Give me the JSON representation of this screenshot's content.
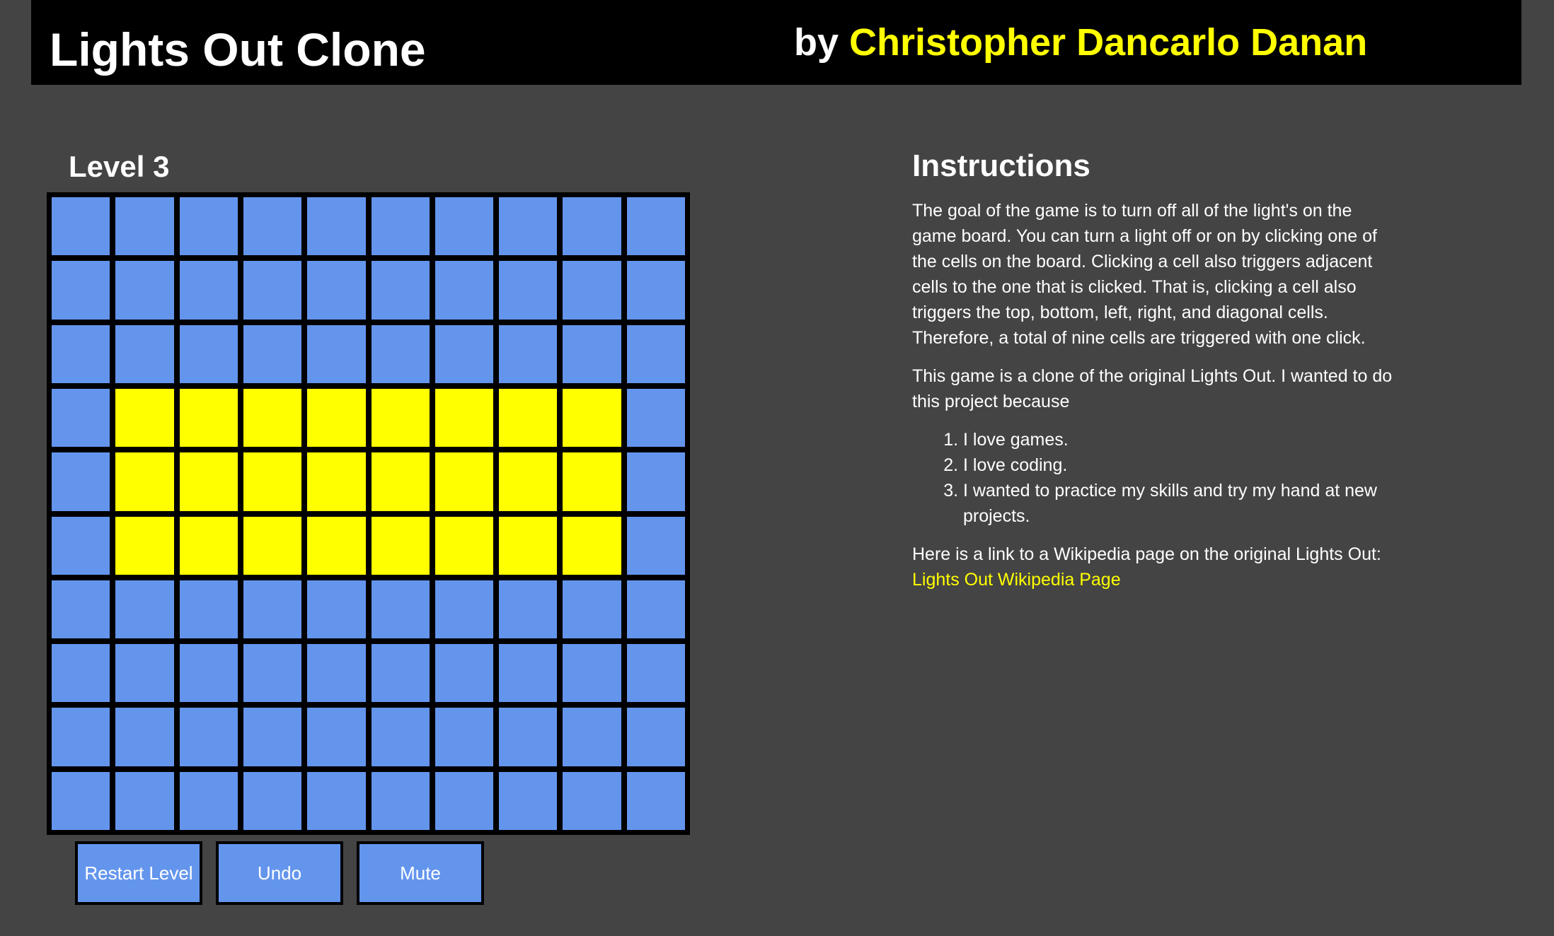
{
  "header": {
    "title": "Lights Out Clone",
    "by_label": "by",
    "author": "Christopher Dancarlo Danan"
  },
  "game": {
    "level_label": "Level 3",
    "board": {
      "rows": 10,
      "cols": 10,
      "cells": [
        [
          0,
          0,
          0,
          0,
          0,
          0,
          0,
          0,
          0,
          0
        ],
        [
          0,
          0,
          0,
          0,
          0,
          0,
          0,
          0,
          0,
          0
        ],
        [
          0,
          0,
          0,
          0,
          0,
          0,
          0,
          0,
          0,
          0
        ],
        [
          0,
          1,
          1,
          1,
          1,
          1,
          1,
          1,
          1,
          0
        ],
        [
          0,
          1,
          1,
          1,
          1,
          1,
          1,
          1,
          1,
          0
        ],
        [
          0,
          1,
          1,
          1,
          1,
          1,
          1,
          1,
          1,
          0
        ],
        [
          0,
          0,
          0,
          0,
          0,
          0,
          0,
          0,
          0,
          0
        ],
        [
          0,
          0,
          0,
          0,
          0,
          0,
          0,
          0,
          0,
          0
        ],
        [
          0,
          0,
          0,
          0,
          0,
          0,
          0,
          0,
          0,
          0
        ],
        [
          0,
          0,
          0,
          0,
          0,
          0,
          0,
          0,
          0,
          0
        ]
      ]
    },
    "buttons": {
      "restart": "Restart Level",
      "undo": "Undo",
      "mute": "Mute"
    }
  },
  "instructions": {
    "heading": "Instructions",
    "paragraph1": "The goal of the game is to turn off all of the light's on the game board. You can turn a light off or on by clicking one of the cells on the board. Clicking a cell also triggers adjacent cells to the one that is clicked. That is, clicking a cell also triggers the top, bottom, left, right, and diagonal cells. Therefore, a total of nine cells are triggered with one click.",
    "paragraph2": "This game is a clone of the original Lights Out. I wanted to do this project because",
    "reasons": [
      "I love games.",
      "I love coding.",
      "I wanted to practice my skills and try my hand at new projects."
    ],
    "link_intro": "Here is a link to a Wikipedia page on the original Lights Out: ",
    "link_text": "Lights Out Wikipedia Page"
  },
  "colors": {
    "background": "#444444",
    "header": "#000000",
    "accent": "#ffff00",
    "cell_off": "#6495ed",
    "cell_on": "#ffff00"
  }
}
